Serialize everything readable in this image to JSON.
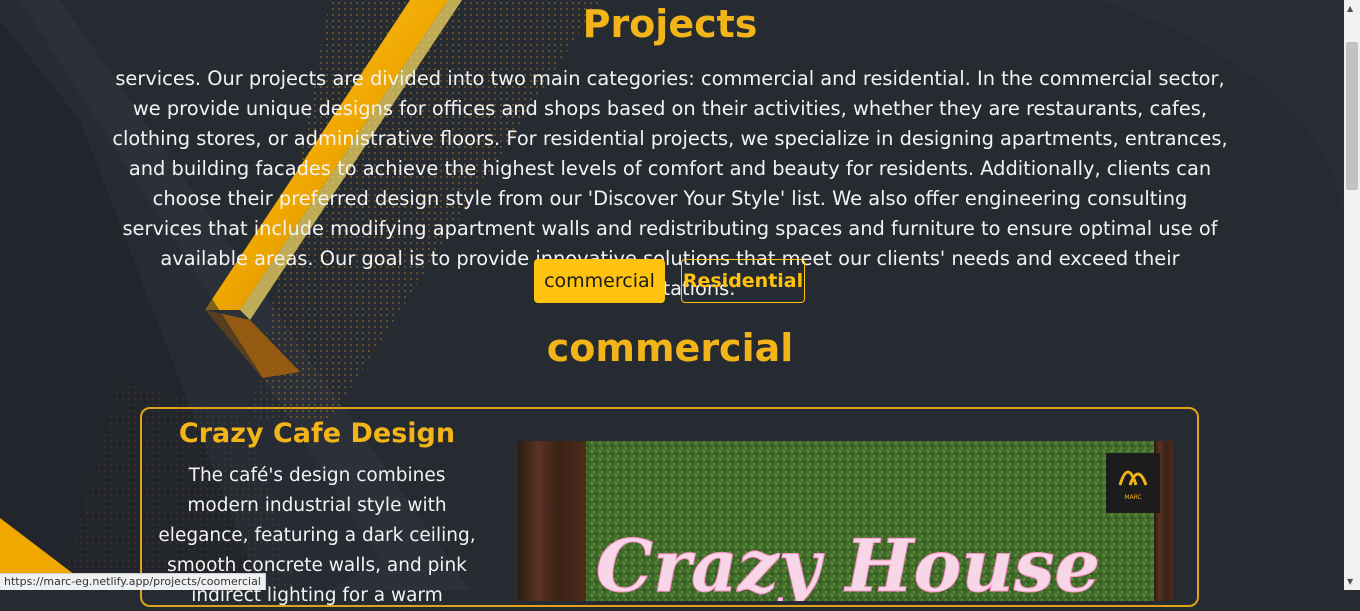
{
  "header": {
    "title": "Projects"
  },
  "intro": {
    "text": "services. Our projects are divided into two main categories: commercial and residential. In the commercial sector, we provide unique designs for offices and shops based on their activities, whether they are restaurants, cafes, clothing stores, or administrative floors. For residential projects, we specialize in designing apartments, entrances, and building facades to achieve the highest levels of comfort and beauty for residents. Additionally, clients can choose their preferred design style from our 'Discover Your Style' list. We also offer engineering consulting services that include modifying apartment walls and redistributing spaces and furniture to ensure optimal use of available areas. Our goal is to provide innovative solutions that meet our clients' needs and exceed their expectations."
  },
  "tabs": [
    {
      "label": "commercial",
      "active": true
    },
    {
      "label": "Residential",
      "active": false
    }
  ],
  "section": {
    "title": "commercial"
  },
  "project": {
    "title": "Crazy Cafe Design",
    "description": "The café's design combines modern industrial style with elegance, featuring a dark ceiling, smooth concrete walls, and pink indirect lighting for a warm",
    "image_sign_text": "Crazy House",
    "logo_text": "MARC"
  },
  "status_bar": {
    "url": "https://marc-eg.netlify.app/projects/coomercial"
  },
  "colors": {
    "accent": "#ffc20e",
    "heading": "#f2b418",
    "background": "#262a31"
  }
}
